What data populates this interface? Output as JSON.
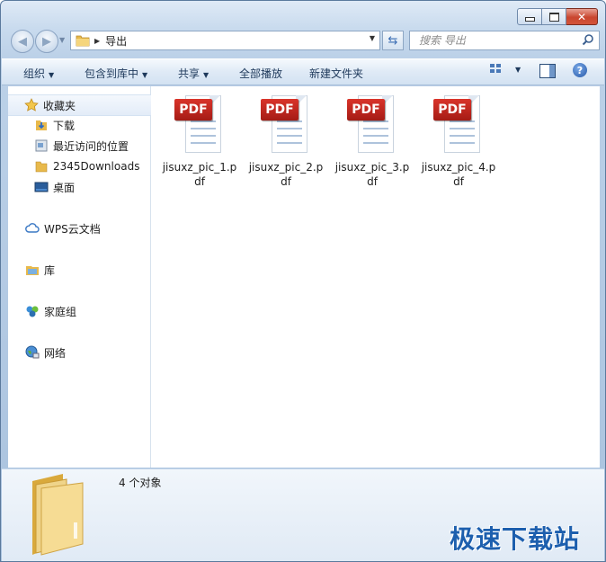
{
  "address": {
    "crumb": "导出"
  },
  "search": {
    "placeholder": "搜索 导出"
  },
  "toolbar": {
    "organize": "组织",
    "include_in_library": "包含到库中",
    "share": "共享",
    "play_all": "全部播放",
    "new_folder": "新建文件夹"
  },
  "navpane": {
    "favorites": "收藏夹",
    "downloads": "下载",
    "recent_places": "最近访问的位置",
    "downloads_2345": "2345Downloads",
    "desktop": "桌面",
    "wps_cloud": "WPS云文档",
    "libraries": "库",
    "homegroup": "家庭组",
    "network": "网络"
  },
  "files": [
    {
      "badge": "PDF",
      "name": "jisuxz_pic_1.pdf"
    },
    {
      "badge": "PDF",
      "name": "jisuxz_pic_2.pdf"
    },
    {
      "badge": "PDF",
      "name": "jisuxz_pic_3.pdf"
    },
    {
      "badge": "PDF",
      "name": "jisuxz_pic_4.pdf"
    }
  ],
  "details": {
    "count": "4 个对象"
  },
  "watermark": "极速下载站",
  "colors": {
    "pdf_badge": "#c62820",
    "folder": "#f1c96b",
    "accent": "#1d5fae"
  }
}
